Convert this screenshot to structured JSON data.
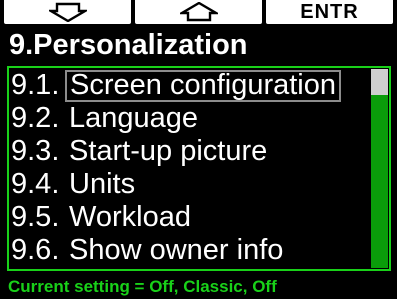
{
  "softkeys": {
    "down_icon": "down-arrow-outline",
    "up_icon": "up-arrow-outline",
    "enter_label": "ENTR"
  },
  "title": "9.Personalization",
  "menu": {
    "items": [
      {
        "number": "9.1.",
        "label": "Screen configuration",
        "selected": true
      },
      {
        "number": "9.2.",
        "label": "Language",
        "selected": false
      },
      {
        "number": "9.3.",
        "label": "Start-up picture",
        "selected": false
      },
      {
        "number": "9.4.",
        "label": "Units",
        "selected": false
      },
      {
        "number": "9.5.",
        "label": "Workload",
        "selected": false
      },
      {
        "number": "9.6.",
        "label": "Show owner info",
        "selected": false
      }
    ],
    "scroll_position": 0
  },
  "status": "Current setting = Off, Classic, Off",
  "colors": {
    "accent_green": "#19d119",
    "scrollbar_green": "#0a9c0a",
    "selection_border": "#8c8c8c",
    "background": "#000000",
    "softkey_bg": "#ffffff"
  }
}
